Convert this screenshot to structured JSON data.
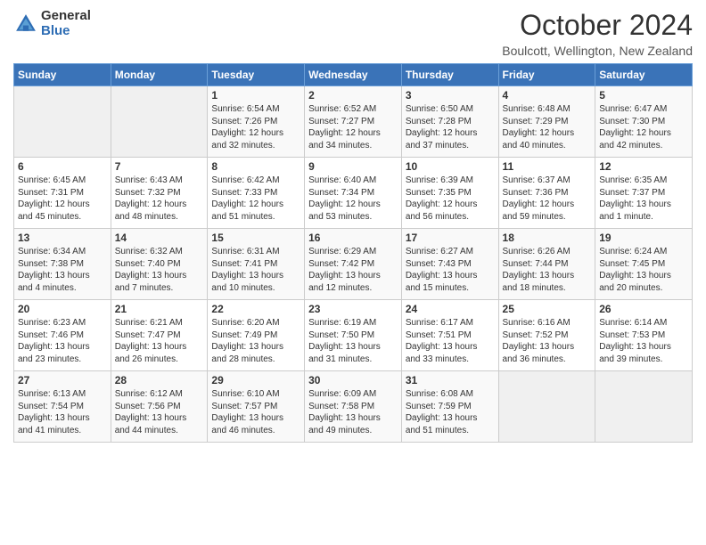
{
  "header": {
    "logo_general": "General",
    "logo_blue": "Blue",
    "month_title": "October 2024",
    "location": "Boulcott, Wellington, New Zealand"
  },
  "days_of_week": [
    "Sunday",
    "Monday",
    "Tuesday",
    "Wednesday",
    "Thursday",
    "Friday",
    "Saturday"
  ],
  "weeks": [
    [
      {
        "day": "",
        "text": ""
      },
      {
        "day": "",
        "text": ""
      },
      {
        "day": "1",
        "text": "Sunrise: 6:54 AM\nSunset: 7:26 PM\nDaylight: 12 hours\nand 32 minutes."
      },
      {
        "day": "2",
        "text": "Sunrise: 6:52 AM\nSunset: 7:27 PM\nDaylight: 12 hours\nand 34 minutes."
      },
      {
        "day": "3",
        "text": "Sunrise: 6:50 AM\nSunset: 7:28 PM\nDaylight: 12 hours\nand 37 minutes."
      },
      {
        "day": "4",
        "text": "Sunrise: 6:48 AM\nSunset: 7:29 PM\nDaylight: 12 hours\nand 40 minutes."
      },
      {
        "day": "5",
        "text": "Sunrise: 6:47 AM\nSunset: 7:30 PM\nDaylight: 12 hours\nand 42 minutes."
      }
    ],
    [
      {
        "day": "6",
        "text": "Sunrise: 6:45 AM\nSunset: 7:31 PM\nDaylight: 12 hours\nand 45 minutes."
      },
      {
        "day": "7",
        "text": "Sunrise: 6:43 AM\nSunset: 7:32 PM\nDaylight: 12 hours\nand 48 minutes."
      },
      {
        "day": "8",
        "text": "Sunrise: 6:42 AM\nSunset: 7:33 PM\nDaylight: 12 hours\nand 51 minutes."
      },
      {
        "day": "9",
        "text": "Sunrise: 6:40 AM\nSunset: 7:34 PM\nDaylight: 12 hours\nand 53 minutes."
      },
      {
        "day": "10",
        "text": "Sunrise: 6:39 AM\nSunset: 7:35 PM\nDaylight: 12 hours\nand 56 minutes."
      },
      {
        "day": "11",
        "text": "Sunrise: 6:37 AM\nSunset: 7:36 PM\nDaylight: 12 hours\nand 59 minutes."
      },
      {
        "day": "12",
        "text": "Sunrise: 6:35 AM\nSunset: 7:37 PM\nDaylight: 13 hours\nand 1 minute."
      }
    ],
    [
      {
        "day": "13",
        "text": "Sunrise: 6:34 AM\nSunset: 7:38 PM\nDaylight: 13 hours\nand 4 minutes."
      },
      {
        "day": "14",
        "text": "Sunrise: 6:32 AM\nSunset: 7:40 PM\nDaylight: 13 hours\nand 7 minutes."
      },
      {
        "day": "15",
        "text": "Sunrise: 6:31 AM\nSunset: 7:41 PM\nDaylight: 13 hours\nand 10 minutes."
      },
      {
        "day": "16",
        "text": "Sunrise: 6:29 AM\nSunset: 7:42 PM\nDaylight: 13 hours\nand 12 minutes."
      },
      {
        "day": "17",
        "text": "Sunrise: 6:27 AM\nSunset: 7:43 PM\nDaylight: 13 hours\nand 15 minutes."
      },
      {
        "day": "18",
        "text": "Sunrise: 6:26 AM\nSunset: 7:44 PM\nDaylight: 13 hours\nand 18 minutes."
      },
      {
        "day": "19",
        "text": "Sunrise: 6:24 AM\nSunset: 7:45 PM\nDaylight: 13 hours\nand 20 minutes."
      }
    ],
    [
      {
        "day": "20",
        "text": "Sunrise: 6:23 AM\nSunset: 7:46 PM\nDaylight: 13 hours\nand 23 minutes."
      },
      {
        "day": "21",
        "text": "Sunrise: 6:21 AM\nSunset: 7:47 PM\nDaylight: 13 hours\nand 26 minutes."
      },
      {
        "day": "22",
        "text": "Sunrise: 6:20 AM\nSunset: 7:49 PM\nDaylight: 13 hours\nand 28 minutes."
      },
      {
        "day": "23",
        "text": "Sunrise: 6:19 AM\nSunset: 7:50 PM\nDaylight: 13 hours\nand 31 minutes."
      },
      {
        "day": "24",
        "text": "Sunrise: 6:17 AM\nSunset: 7:51 PM\nDaylight: 13 hours\nand 33 minutes."
      },
      {
        "day": "25",
        "text": "Sunrise: 6:16 AM\nSunset: 7:52 PM\nDaylight: 13 hours\nand 36 minutes."
      },
      {
        "day": "26",
        "text": "Sunrise: 6:14 AM\nSunset: 7:53 PM\nDaylight: 13 hours\nand 39 minutes."
      }
    ],
    [
      {
        "day": "27",
        "text": "Sunrise: 6:13 AM\nSunset: 7:54 PM\nDaylight: 13 hours\nand 41 minutes."
      },
      {
        "day": "28",
        "text": "Sunrise: 6:12 AM\nSunset: 7:56 PM\nDaylight: 13 hours\nand 44 minutes."
      },
      {
        "day": "29",
        "text": "Sunrise: 6:10 AM\nSunset: 7:57 PM\nDaylight: 13 hours\nand 46 minutes."
      },
      {
        "day": "30",
        "text": "Sunrise: 6:09 AM\nSunset: 7:58 PM\nDaylight: 13 hours\nand 49 minutes."
      },
      {
        "day": "31",
        "text": "Sunrise: 6:08 AM\nSunset: 7:59 PM\nDaylight: 13 hours\nand 51 minutes."
      },
      {
        "day": "",
        "text": ""
      },
      {
        "day": "",
        "text": ""
      }
    ]
  ]
}
